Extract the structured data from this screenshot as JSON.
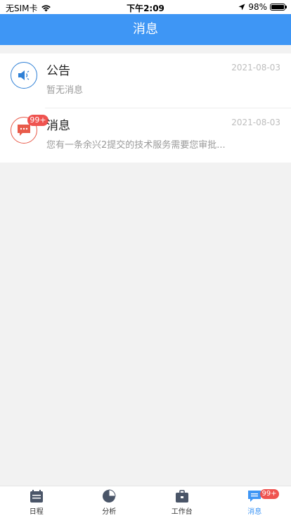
{
  "status_bar": {
    "carrier": "无SIM卡",
    "time": "下午2:09",
    "battery": "98%",
    "battery_level": 0.98
  },
  "nav": {
    "title": "消息"
  },
  "items": [
    {
      "icon": "speaker-icon",
      "title": "公告",
      "date": "2021-08-03",
      "subtitle": "暂无消息",
      "color": "#2f80d6"
    },
    {
      "icon": "chat-bubble-icon",
      "badge": "99+",
      "title": "消息",
      "date": "2021-08-03",
      "subtitle": "您有一条余兴2提交的技术服务需要您审批...",
      "color": "#e85b4a"
    }
  ],
  "tabbar": {
    "tabs": [
      {
        "label": "日程",
        "icon": "calendar-icon"
      },
      {
        "label": "分析",
        "icon": "pie-chart-icon"
      },
      {
        "label": "工作台",
        "icon": "briefcase-icon"
      },
      {
        "label": "消息",
        "icon": "message-icon",
        "badge": "99+",
        "active": true
      }
    ]
  },
  "colors": {
    "primary": "#3e96f5",
    "badge": "#ef5350"
  }
}
